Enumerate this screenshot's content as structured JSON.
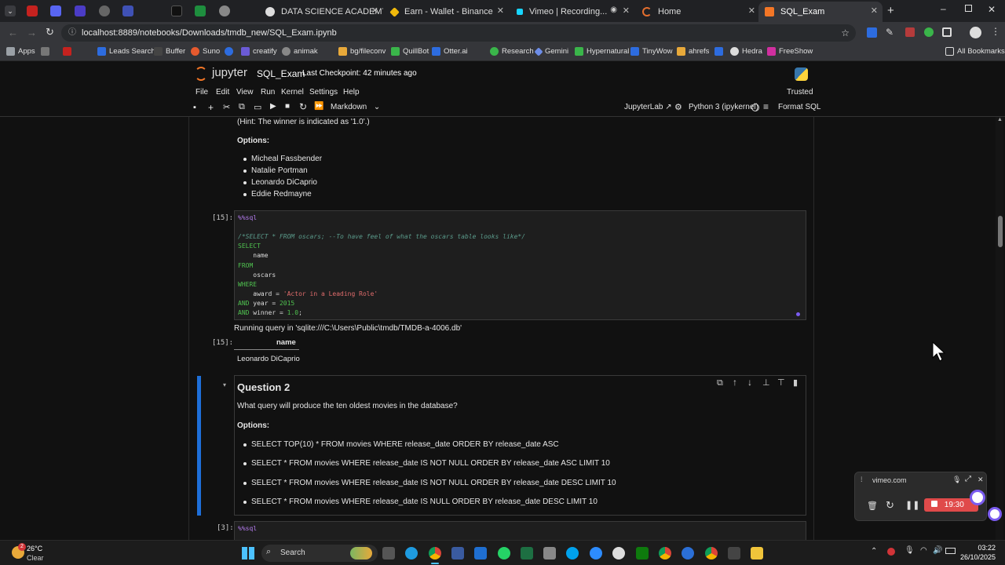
{
  "browser": {
    "tabs": [
      {
        "label": "DATA SCIENCE ACADEMY",
        "active": false
      },
      {
        "label": "Earn - Wallet - Binance",
        "active": false
      },
      {
        "label": "Vimeo | Recording...",
        "active": false
      },
      {
        "label": "Home",
        "active": false
      },
      {
        "label": "SQL_Exam",
        "active": true
      }
    ],
    "url": "localhost:8889/notebooks/Downloads/tmdb_new/SQL_Exam.ipynb",
    "bookmarks": [
      "Apps",
      "Leads Search",
      "Buffer",
      "Suno",
      "creatify",
      "animak",
      "bg/fileconv",
      "QuillBot",
      "Otter.ai",
      "Research",
      "Gemini",
      "Hypernatural",
      "TinyWow",
      "ahrefs",
      "Hedra",
      "FreeShow"
    ],
    "all_bookmarks": "All Bookmarks"
  },
  "jupyter": {
    "logo": "jupyter",
    "notebook_name": "SQL_Exam",
    "checkpoint": "Last Checkpoint: 42 minutes ago",
    "trusted": "Trusted",
    "menu": [
      "File",
      "Edit",
      "View",
      "Run",
      "Kernel",
      "Settings",
      "Help"
    ],
    "cell_type": "Markdown",
    "jupyterlab": "JupyterLab",
    "kernel": "Python 3 (ipykernel)",
    "format_sql": "Format SQL"
  },
  "cells": {
    "hint": "(Hint: The winner is indicated as '1.0'.)",
    "options_label": "Options:",
    "q1_options": [
      "Micheal Fassbender",
      "Natalie Portman",
      "Leonardo DiCaprio",
      "Eddie Redmayne"
    ],
    "code15_prompt": "[15]:",
    "code15_lines": [
      {
        "parts": [
          {
            "t": "%%sql",
            "c": "magic"
          }
        ]
      },
      {
        "parts": []
      },
      {
        "parts": [
          {
            "t": "/*SELECT * FROM oscars; --To have feel of what the oscars table looks like*/",
            "c": "cmt"
          }
        ]
      },
      {
        "parts": [
          {
            "t": "SELECT",
            "c": "kw"
          }
        ]
      },
      {
        "parts": [
          {
            "t": "    name",
            "c": "plain"
          }
        ]
      },
      {
        "parts": [
          {
            "t": "FROM",
            "c": "kw"
          }
        ]
      },
      {
        "parts": [
          {
            "t": "    oscars",
            "c": "plain"
          }
        ]
      },
      {
        "parts": [
          {
            "t": "WHERE",
            "c": "kw"
          }
        ]
      },
      {
        "parts": [
          {
            "t": "    award = ",
            "c": "plain"
          },
          {
            "t": "'Actor in a Leading Role'",
            "c": "str"
          }
        ]
      },
      {
        "parts": [
          {
            "t": "AND ",
            "c": "kw"
          },
          {
            "t": "year = ",
            "c": "plain"
          },
          {
            "t": "2015",
            "c": "num"
          }
        ]
      },
      {
        "parts": [
          {
            "t": "AND ",
            "c": "kw"
          },
          {
            "t": "winner = ",
            "c": "plain"
          },
          {
            "t": "1.0",
            "c": "num"
          },
          {
            "t": ";",
            "c": "plain"
          }
        ]
      }
    ],
    "running_query": "Running query in 'sqlite:///C:\\Users\\Public\\tmdb/TMDB-a-4006.db'",
    "out15_prompt": "[15]:",
    "out_header": "name",
    "out_value": "Leonardo DiCaprio",
    "q2_title": "Question 2",
    "q2_text": "What query will produce the ten oldest movies in the database?",
    "q2_options": [
      "SELECT TOP(10) * FROM movies WHERE release_date ORDER BY release_date ASC",
      "SELECT * FROM movies WHERE release_date IS NOT NULL ORDER BY release_date ASC LIMIT 10",
      "SELECT * FROM movies WHERE release_date IS NOT NULL ORDER BY release_date DESC LIMIT 10",
      "SELECT * FROM movies WHERE release_date IS NULL ORDER BY release_date DESC LIMIT 10"
    ],
    "code3_prompt": "[3]:",
    "code3_first": "%%sql"
  },
  "vimeo_widget": {
    "site": "vimeo.com",
    "timer": "19:30"
  },
  "taskbar": {
    "weather_temp": "26°C",
    "weather_desc": "Clear",
    "search": "Search",
    "time": "03:22",
    "date": "26/10/2025",
    "notif_count": "2"
  },
  "colors": {
    "accent": "#1e6fd9",
    "active_cell_bar": "#1e6fd9",
    "record": "#e04a4a"
  }
}
